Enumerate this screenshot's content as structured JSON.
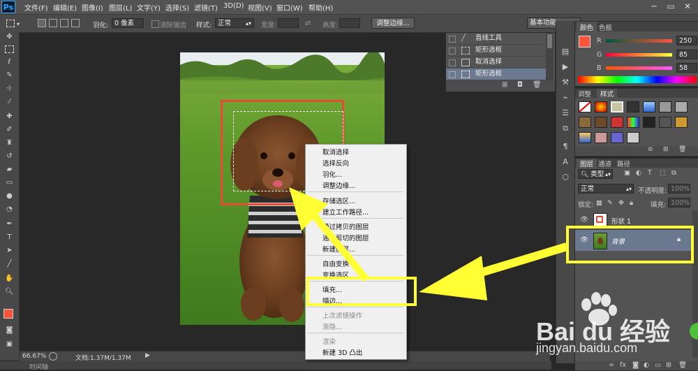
{
  "app": {
    "logo": "Ps"
  },
  "menubar": [
    "文件(F)",
    "编辑(E)",
    "图像(I)",
    "图层(L)",
    "文字(Y)",
    "选择(S)",
    "滤镜(T)",
    "3D(D)",
    "视图(V)",
    "窗口(W)",
    "帮助(H)"
  ],
  "window_controls": [
    "─",
    "▭",
    "✕"
  ],
  "options": {
    "feather_label": "羽化:",
    "feather_value": "0 像素",
    "antialias_label": "消除锯齿",
    "style_label": "样式:",
    "style_value": "正常",
    "width_label": "宽度:",
    "height_label": "高度:",
    "refine_button": "调整边缘...",
    "workspace": "基本功能"
  },
  "history": {
    "items": [
      "直线工具",
      "矩形选框",
      "取消选择",
      "矩形选框"
    ]
  },
  "color_panel": {
    "tabs": [
      "颜色",
      "色板"
    ],
    "r_label": "R",
    "g_label": "G",
    "b_label": "B",
    "r": "250",
    "g": "85",
    "b": "58",
    "foreground": "#fa553a"
  },
  "styles_panel": {
    "tabs": [
      "调整",
      "样式"
    ]
  },
  "layers_panel": {
    "tabs": [
      "图层",
      "通道",
      "路径"
    ],
    "kind_label": "类型",
    "blend_mode": "正常",
    "opacity_label": "不透明度:",
    "opacity_value": "100%",
    "lock_label": "锁定:",
    "fill_label": "填充:",
    "fill_value": "100%",
    "layers": [
      {
        "name": "形状 1"
      },
      {
        "name": "背景"
      }
    ]
  },
  "status": {
    "zoom": "66.67%",
    "doc": "文档:1.37M/1.37M",
    "timeline": "时间轴"
  },
  "context_menu": {
    "items": [
      {
        "label": "取消选择",
        "enabled": true
      },
      {
        "label": "选择反向",
        "enabled": true
      },
      {
        "label": "羽化...",
        "enabled": true
      },
      {
        "label": "调整边缘...",
        "enabled": true
      },
      {
        "label": "存储选区...",
        "enabled": true
      },
      {
        "label": "建立工作路径...",
        "enabled": true
      },
      {
        "label": "通过拷贝的图层",
        "enabled": true
      },
      {
        "label": "通过剪切的图层",
        "enabled": true
      },
      {
        "label": "新建图层...",
        "enabled": true
      },
      {
        "label": "自由变换",
        "enabled": true
      },
      {
        "label": "变换选区",
        "enabled": true
      },
      {
        "label": "填充...",
        "enabled": true
      },
      {
        "label": "描边...",
        "enabled": true
      },
      {
        "label": "上次滤镜操作",
        "enabled": false
      },
      {
        "label": "渐隐...",
        "enabled": false
      },
      {
        "label": "渲染",
        "enabled": false
      },
      {
        "label": "新建 3D 凸出",
        "enabled": true
      }
    ]
  },
  "watermark": {
    "brand": "Bai du 经验",
    "url": "jingyan.baidu.com"
  },
  "colors": {
    "annotation_yellow": "#ffff33",
    "selection_red": "#e84a35"
  }
}
